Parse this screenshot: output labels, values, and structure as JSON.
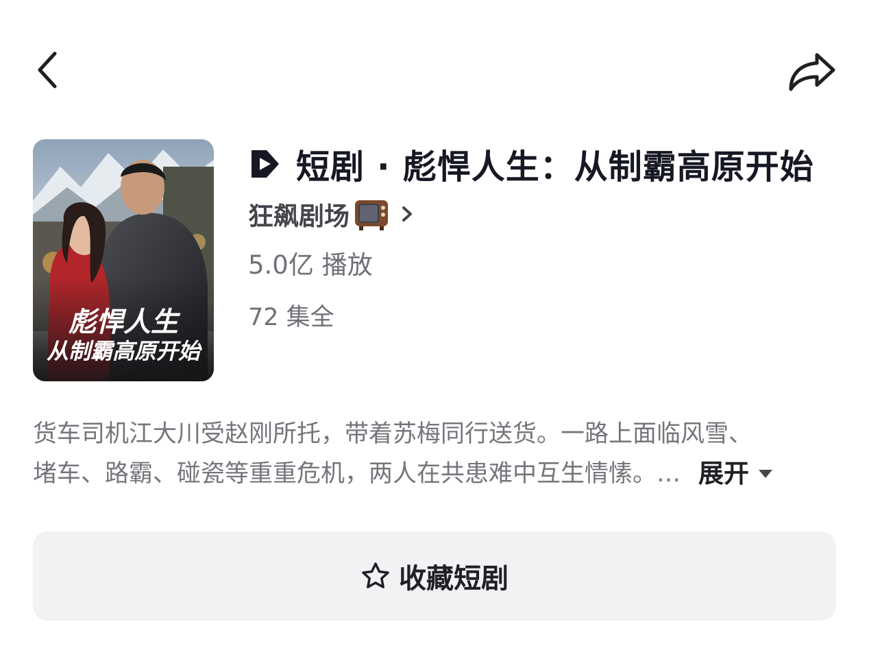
{
  "header": {
    "back_icon": "chevron-left-icon",
    "share_icon": "share-arrow-icon"
  },
  "drama": {
    "poster": {
      "title_line1": "彪悍人生",
      "title_line2": "从制霸高原开始"
    },
    "title": "短剧 · 彪悍人生：从制霸高原开始",
    "title_icon": "play-badge-icon",
    "author": "狂飙剧场",
    "author_emoji": "📺",
    "plays": "5.0亿 播放",
    "episodes": "72 集全",
    "description_line1": "货车司机江大川受赵刚所托，带着苏梅同行送货。一路上面临风雪、",
    "description_line2": "堵车、路霸、碰瓷等重重危机，两人在共患难中互生情愫。…",
    "expand_label": "展开"
  },
  "actions": {
    "collect_label": "收藏短剧",
    "collect_icon": "star-outline-icon"
  },
  "colors": {
    "accent_dark": "#161823",
    "secondary_text": "#6f7077",
    "button_bg": "#f2f2f4"
  }
}
